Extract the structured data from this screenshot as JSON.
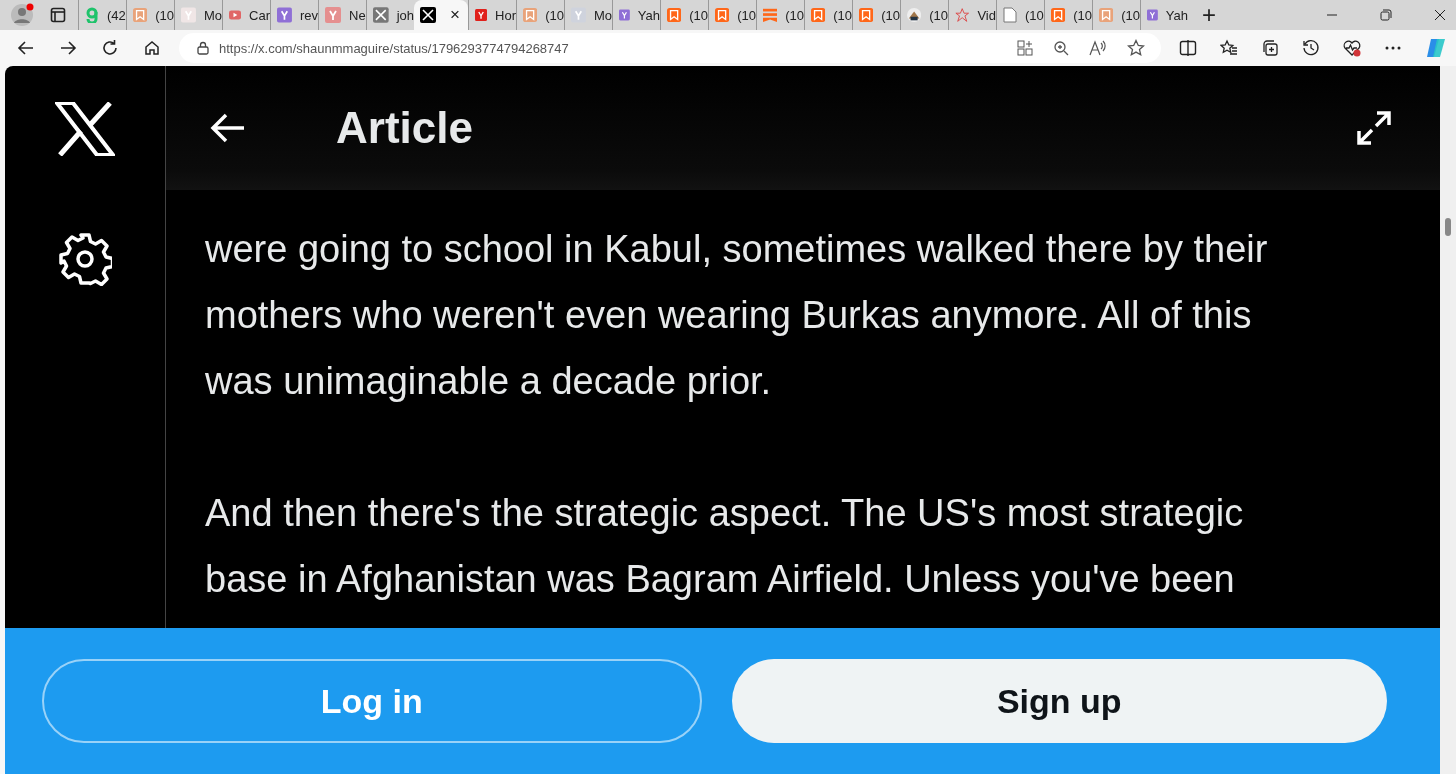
{
  "browser": {
    "tabs": [
      {
        "kind": "green",
        "title": "(42",
        "selected": false
      },
      {
        "kind": "bookmark-faded",
        "title": "(10",
        "selected": false
      },
      {
        "kind": "serif",
        "title": "Mo",
        "selected": false
      },
      {
        "kind": "play",
        "title": "Car",
        "selected": false
      },
      {
        "kind": "purple",
        "title": "rev",
        "selected": false
      },
      {
        "kind": "pink",
        "title": "Ne",
        "selected": false
      },
      {
        "kind": "cross-gray",
        "title": "joh",
        "selected": false
      },
      {
        "kind": "cross",
        "title": "×",
        "selected": true
      },
      {
        "kind": "red",
        "title": "Hor",
        "selected": false
      },
      {
        "kind": "bookmark-faded",
        "title": "(10",
        "selected": false
      },
      {
        "kind": "faded",
        "title": "Mo",
        "selected": false
      },
      {
        "kind": "purple",
        "title": "Yah",
        "selected": false
      },
      {
        "kind": "bookmark",
        "title": "(10",
        "selected": false
      },
      {
        "kind": "bookmark",
        "title": "(10",
        "selected": false
      },
      {
        "kind": "banner",
        "title": "(10",
        "selected": false
      },
      {
        "kind": "bookmark",
        "title": "(10",
        "selected": false
      },
      {
        "kind": "bookmark",
        "title": "(10",
        "selected": false
      },
      {
        "kind": "round",
        "title": "(10",
        "selected": false
      },
      {
        "kind": "star",
        "title": "Vid",
        "selected": false
      },
      {
        "kind": "page",
        "title": "(10",
        "selected": false
      },
      {
        "kind": "bookmark",
        "title": "(10",
        "selected": false
      },
      {
        "kind": "bookmark-faded",
        "title": "(10",
        "selected": false
      },
      {
        "kind": "purple",
        "title": "Yah",
        "selected": false
      }
    ],
    "new_tab": "+",
    "url": "https://x.com/shaunmmaguire/status/1796293774794268747"
  },
  "header": {
    "title": "Article"
  },
  "article": {
    "paragraphs": [
      {
        "lines": [
          "were going to school in Kabul, sometimes walked there by their",
          "mothers who weren't even wearing Burkas anymore. All of this",
          "was unimaginable a decade prior."
        ]
      },
      {
        "lines": [
          "And then there's the strategic aspect. The US's most strategic",
          "base in Afghanistan was Bagram Airfield. Unless you've been"
        ]
      }
    ]
  },
  "banner": {
    "buttons": [
      {
        "kind": "outline",
        "label": "Log in"
      },
      {
        "kind": "filled",
        "label": "Sign up"
      }
    ]
  }
}
